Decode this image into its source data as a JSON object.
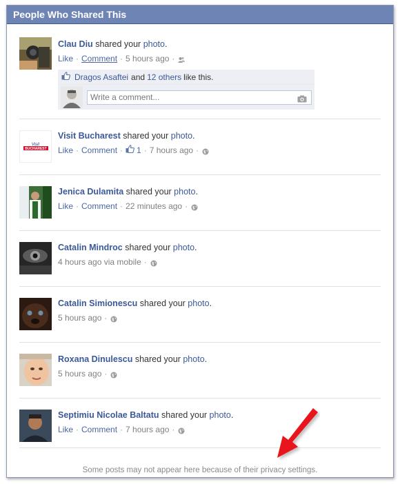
{
  "dialog": {
    "title": "People Who Shared This"
  },
  "common": {
    "shared_your": "shared your",
    "photo": "photo",
    "period": ".",
    "like": "Like",
    "comment": "Comment"
  },
  "stories": [
    {
      "name": "Clau Diu",
      "time": "5 hours ago",
      "privacy_icon": "friends-icon"
    },
    {
      "name": "Visit Bucharest",
      "likes": "1",
      "time": "7 hours ago",
      "privacy_icon": "globe-icon"
    },
    {
      "name": "Jenica Dulamita",
      "time": "22 minutes ago",
      "privacy_icon": "globe-icon"
    },
    {
      "name": "Catalin Mindroc",
      "time": "4 hours ago via mobile",
      "privacy_icon": "globe-icon"
    },
    {
      "name": "Catalin Simionescu",
      "time": "5 hours ago",
      "privacy_icon": "globe-icon"
    },
    {
      "name": "Roxana Dinulescu",
      "time": "5 hours ago",
      "privacy_icon": "globe-icon"
    },
    {
      "name": "Septimiu Nicolae Baltatu",
      "time": "7 hours ago",
      "privacy_icon": "globe-icon"
    }
  ],
  "likes_bar": {
    "liker": "Dragos Asaftei",
    "and": "and",
    "others": "12 others",
    "suffix": "like this."
  },
  "comment_input": {
    "placeholder": "Write a comment..."
  },
  "footer": {
    "text": "Some posts may not appear here because of their privacy settings."
  },
  "colors": {
    "titlebar": "#6d84b4",
    "link": "#3b5998",
    "arrow": "#e8141c"
  }
}
